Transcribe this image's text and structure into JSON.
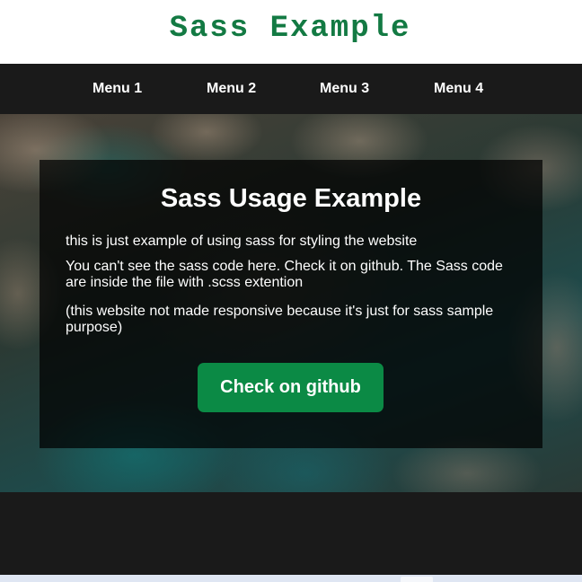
{
  "header": {
    "title": "Sass Example"
  },
  "nav": {
    "items": [
      {
        "label": "Menu 1"
      },
      {
        "label": "Menu 2"
      },
      {
        "label": "Menu 3"
      },
      {
        "label": "Menu 4"
      }
    ]
  },
  "hero": {
    "heading": "Sass Usage Example",
    "paragraphs": [
      "this is just example of using sass for styling the website",
      "You can't see the sass code here. Check it on github. The Sass code are inside the file with .scss extention",
      "(this website not made responsive because it's just for sass sample purpose)"
    ],
    "button_label": "Check on github"
  },
  "colors": {
    "brand_green": "#137a43",
    "button_green": "#0b8a45",
    "dark_background": "#1a1a1a"
  }
}
